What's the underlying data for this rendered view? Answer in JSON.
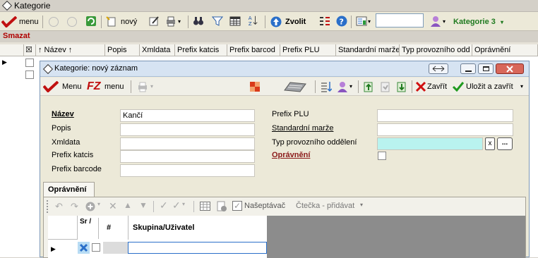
{
  "window": {
    "title": "Kategorie"
  },
  "toolbar": {
    "menu_label": "menu",
    "new_label": "nový",
    "zvolit_label": "Zvolit",
    "search_value": "",
    "category_label": "Kategorie 3",
    "dropdown_caret": "▾"
  },
  "action": {
    "smazat_label": "Smazat"
  },
  "main_grid": {
    "columns": [
      "↑ Název ↑",
      "Popis",
      "Xmldata",
      "Prefix katcis",
      "Prefix barcod",
      "Prefix PLU",
      "Standardní marže",
      "Typ provozního odd",
      "Oprávnění"
    ],
    "checkbox_header": "☒",
    "row_pointer": "▶"
  },
  "dialog": {
    "title": "Kategorie: nový záznam",
    "menu_label": "Menu",
    "fz_label": "FZ",
    "fz_menu_label": "menu",
    "zavrit_label": "Zavřít",
    "ulozit_label": "Uložit a zavřít",
    "fields_left": [
      {
        "label": "Název",
        "value": "Kančí"
      },
      {
        "label": "Popis",
        "value": ""
      },
      {
        "label": "Xmldata",
        "value": ""
      },
      {
        "label": "Prefix katcis",
        "value": ""
      },
      {
        "label": "Prefix barcode",
        "value": ""
      }
    ],
    "fields_right": [
      {
        "label": "Prefix PLU",
        "value": ""
      },
      {
        "label": "Standardní marže",
        "value": ""
      },
      {
        "label": "Typ provozního oddělení",
        "value": ""
      },
      {
        "label": "Oprávnění",
        "value": ""
      }
    ],
    "x_button": "x",
    "ellipsis_button": "...",
    "tab_label": "Oprávnění",
    "subtoolbar": {
      "naseptavac_label": "Našeptávač",
      "ctecka_label": "Čtečka - přidávat"
    },
    "subgrid": {
      "col_sr": "Sr /",
      "col_hash": "#",
      "col_group": "Skupina/Uživatel",
      "row_pointer": "▶"
    }
  },
  "colors": {
    "accent_red": "#b00000",
    "category_green": "#1f7a1f",
    "field_cyan": "#b9f3ef"
  }
}
